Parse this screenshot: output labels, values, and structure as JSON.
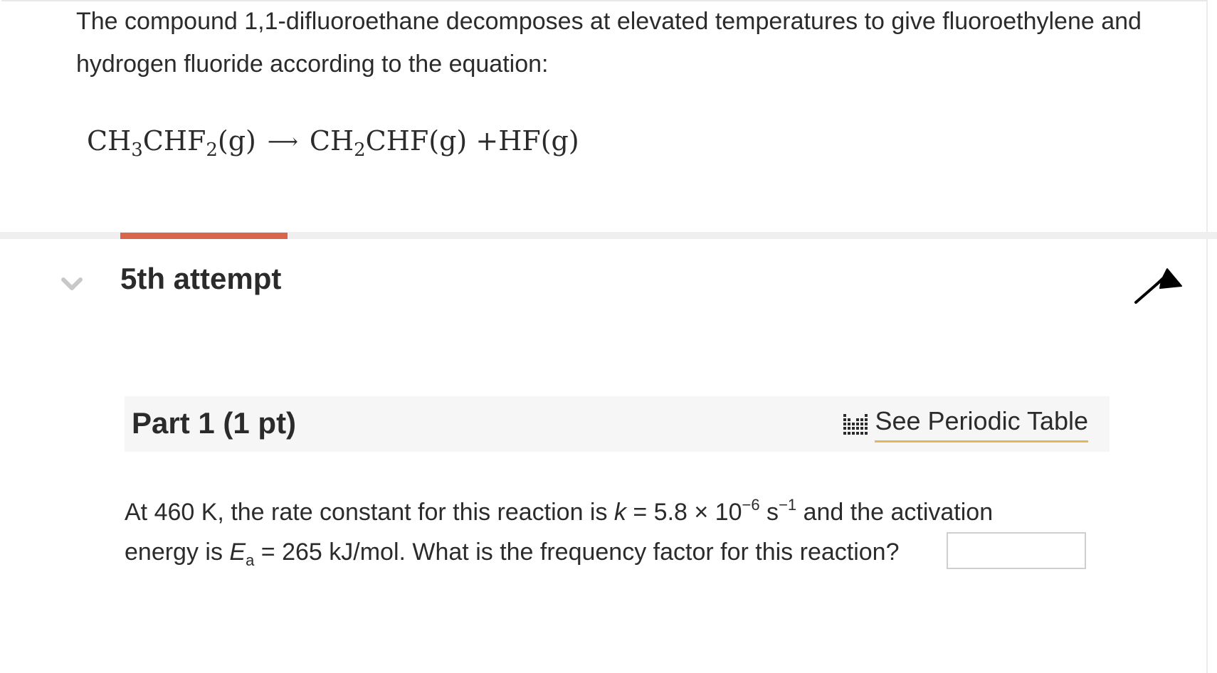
{
  "intro": {
    "line1": "The compound 1,1-difluoroethane decomposes at elevated temperatures to give fluoroethylene and",
    "line2": "hydrogen fluoride according to the equation:"
  },
  "equation": {
    "reactant_a": "CH",
    "reactant_sub1": "3",
    "reactant_b": "CHF",
    "reactant_sub2": "2",
    "reactant_state": "(g)",
    "arrow": "⟶",
    "product1_a": "CH",
    "product1_sub": "2",
    "product1_b": "CHF",
    "product1_state": "(g)",
    "plus": "+",
    "product2": "HF",
    "product2_state": "(g)"
  },
  "attempt": {
    "title": "5th attempt"
  },
  "part": {
    "title": "Part 1 (1 pt)",
    "periodic_table_label": "See Periodic Table"
  },
  "question": {
    "t1": "At 460 K, the rate constant for this reaction is ",
    "k_symbol": "k",
    "t2": " = 5.8 × 10",
    "exp1": "−6",
    "t3": " s",
    "exp2": "−1",
    "t4": " and the activation",
    "t5": "energy is ",
    "ea_symbol": "E",
    "ea_sub": "a",
    "t6": " = 265 kJ/mol. What is the frequency factor for this reaction?",
    "answer_value": ""
  },
  "colors": {
    "accent_progress": "#d9654a",
    "link_underline": "#e2b85a",
    "text": "#2b2b2b"
  },
  "icons": {
    "chevron": "chevron-down-icon",
    "flag": "flag-icon",
    "periodic": "periodic-table-icon"
  }
}
